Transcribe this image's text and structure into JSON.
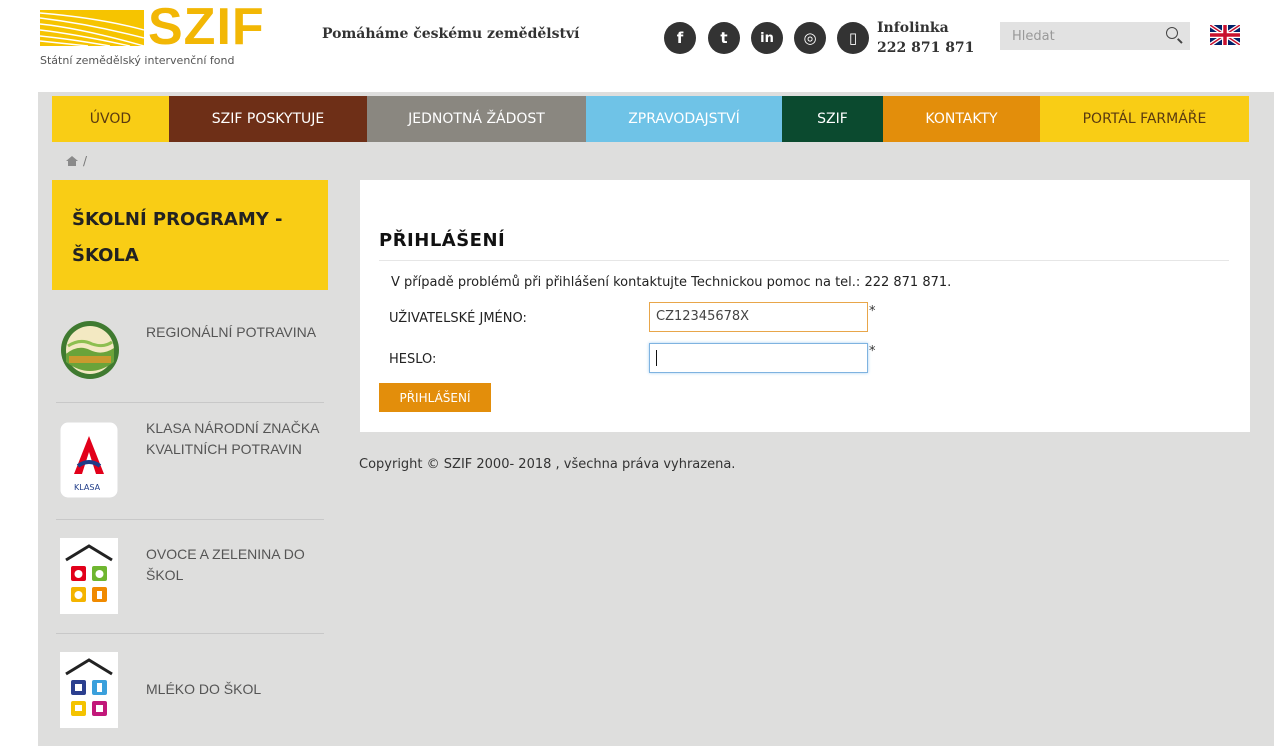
{
  "header": {
    "logo_text": "SZIF",
    "logo_subtitle": "Státní zemědělský intervenční fond",
    "tagline": "Pomáháme českému zemědělství",
    "social": [
      {
        "icon": "facebook-icon",
        "glyph": "f"
      },
      {
        "icon": "twitter-icon",
        "glyph": "t"
      },
      {
        "icon": "linkedin-icon",
        "glyph": "in"
      },
      {
        "icon": "instagram-icon",
        "glyph": "◎"
      },
      {
        "icon": "phone-icon",
        "glyph": "▯"
      }
    ],
    "infolinka_label": "Infolinka",
    "infolinka_number": "222 871 871",
    "search_placeholder": "Hledat",
    "language_flag": "uk-flag-icon"
  },
  "nav": {
    "items": [
      {
        "label": "ÚVOD",
        "bg": "#f9cd15",
        "color": "#5a3a10"
      },
      {
        "label": "SZIF POSKYTUJE",
        "bg": "#6e2f17",
        "color": "#ffffff"
      },
      {
        "label": "JEDNOTNÁ ŽÁDOST",
        "bg": "#8a8780",
        "color": "#ffffff"
      },
      {
        "label": "ZPRAVODAJSTVÍ",
        "bg": "#6fc3e7",
        "color": "#ffffff"
      },
      {
        "label": "SZIF",
        "bg": "#0b4a2f",
        "color": "#ffffff"
      },
      {
        "label": "KONTAKTY",
        "bg": "#e38e0b",
        "color": "#ffffff"
      },
      {
        "label": "PORTÁL FARMÁŘE",
        "bg": "#f9cd15",
        "color": "#5a3a10"
      }
    ]
  },
  "breadcrumb": {
    "separator": "/"
  },
  "sidebar": {
    "title": "ŠKOLNÍ PROGRAMY - ŠKOLA",
    "items": [
      {
        "label": "REGIONÁLNÍ POTRAVINA",
        "icon": "regionalni-potravina-logo"
      },
      {
        "label": "KLASA NÁRODNÍ ZNAČKA KVALITNÍCH POTRAVIN",
        "icon": "klasa-logo"
      },
      {
        "label": "OVOCE A ZELENINA DO ŠKOL",
        "icon": "ovoce-zelenina-logo"
      },
      {
        "label": "MLÉKO DO ŠKOL",
        "icon": "mleko-logo"
      }
    ]
  },
  "login": {
    "title": "PŘIHLÁŠENÍ",
    "note": "V případě problémů při přihlášení kontaktujte Technickou pomoc na tel.: 222 871 871.",
    "username_label": "UŽIVATELSKÉ JMÉNO:",
    "username_value": "CZ12345678X",
    "password_label": "HESLO:",
    "password_value": "",
    "required_mark": "*",
    "submit_label": "PŘIHLÁŠENÍ"
  },
  "footer": {
    "copyright": "Copyright © SZIF 2000- 2018 , všechna práva vyhrazena."
  }
}
